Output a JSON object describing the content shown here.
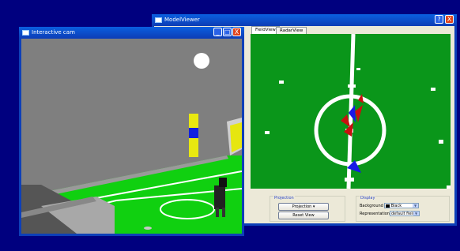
{
  "model_viewer": {
    "title": "ModelViewer",
    "help_label": "?",
    "close_label": "X",
    "tabs": [
      {
        "label": "FieldView",
        "active": true
      },
      {
        "label": "RadarView",
        "active": false
      }
    ],
    "projection": {
      "title": "Projection",
      "projection_button": "Projection",
      "reset_button": "Reset View"
    },
    "display": {
      "title": "Display",
      "background_label": "Background",
      "background_value": "Black",
      "representation_label": "Representation",
      "representation_value": "default field"
    },
    "colors": {
      "field": "#0a961a",
      "team_red": "#c8100f",
      "team_blue": "#1818e6"
    }
  },
  "interactive_cam": {
    "title": "Interactive cam",
    "minimize_label": "_",
    "maximize_label": "□",
    "close_label": "X",
    "colors": {
      "sky": "#7f7f7f",
      "field": "#10d010",
      "pole_yellow": "#e8e810",
      "pole_blue": "#1020e0"
    }
  }
}
